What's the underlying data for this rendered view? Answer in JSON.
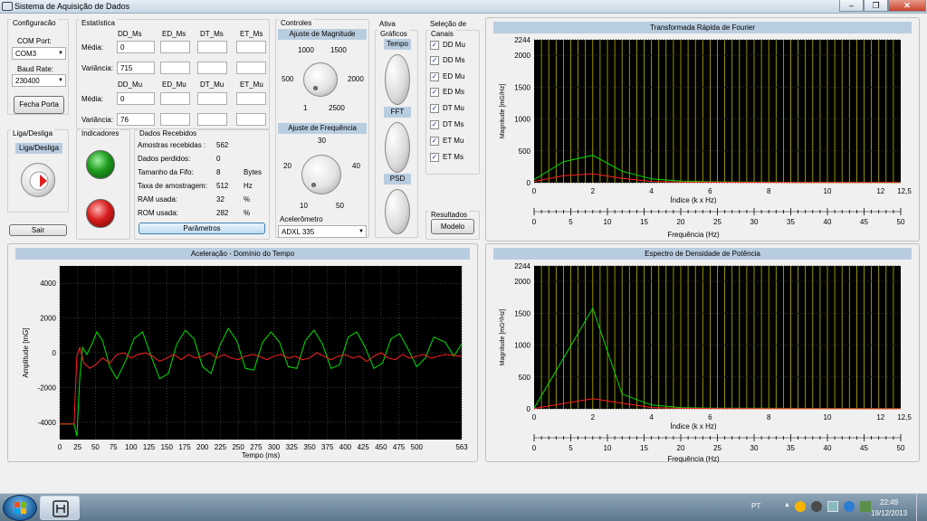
{
  "window": {
    "title": "Sistema de Aquisição de Dados",
    "controls": {
      "minimize": "–",
      "maximize": "❐",
      "close": "✕"
    }
  },
  "config": {
    "group": "Configuracão",
    "com_port_label": "COM Port:",
    "com_port": "COM3",
    "baud_label": "Baud Rate:",
    "baud": "230400",
    "close_port": "Fecha Porta"
  },
  "stats": {
    "group": "Estatística",
    "ms_headers": [
      "DD_Ms",
      "ED_Ms",
      "DT_Ms",
      "ET_Ms"
    ],
    "mu_headers": [
      "DD_Mu",
      "ED_Mu",
      "DT_Mu",
      "ET_Mu"
    ],
    "media_label": "Média:",
    "var_label": "Variância:",
    "ms_media": [
      "0",
      "",
      "",
      ""
    ],
    "ms_var": [
      "715",
      "",
      "",
      ""
    ],
    "mu_media": [
      "0",
      "",
      "",
      ""
    ],
    "mu_var": [
      "76",
      "",
      "",
      ""
    ]
  },
  "power": {
    "group": "Liga/Desliga",
    "label": "Liga/Desliga",
    "exit": "Sair"
  },
  "indicators": {
    "group": "Indicadores",
    "colors": {
      "green": "#1c9b1c",
      "red": "#d81c1c"
    }
  },
  "received": {
    "group": "Dados Recebidos",
    "rows": [
      {
        "label": "Amostras recebidas :",
        "value": "562",
        "unit": ""
      },
      {
        "label": "Dados perdidos:",
        "value": "0",
        "unit": ""
      },
      {
        "label": "Tamanho da Fifo:",
        "value": "8",
        "unit": "Bytes"
      },
      {
        "label": "Taxa de amostragem:",
        "value": "512",
        "unit": "Hz"
      },
      {
        "label": "RAM usada:",
        "value": "32",
        "unit": "%"
      },
      {
        "label": "ROM usada:",
        "value": "282",
        "unit": "%"
      }
    ],
    "params_button": "Parâmetros"
  },
  "controls": {
    "group": "Controles",
    "magnitude_header": "Ajuste de Magnitude",
    "magnitude_ticks": [
      "1000",
      "1500",
      "500",
      "2000",
      "1",
      "2500"
    ],
    "frequency_header": "Ajuste de Frequência",
    "frequency_ticks": [
      "30",
      "20",
      "40",
      "10",
      "50"
    ],
    "accelerometer_label": "Acelerômetro",
    "accelerometer": "ADXL 335"
  },
  "graphs": {
    "group": "Ativa Gráficos",
    "group_line2": "Gráficos",
    "group_line1": "Ativa",
    "items": [
      "Tempo",
      "FFT",
      "PSD"
    ]
  },
  "channels": {
    "group_line1": "Seleção de",
    "group_line2": "Canais",
    "items": [
      "DD Mu",
      "DD Ms",
      "ED Mu",
      "ED Ms",
      "DT Mu",
      "DT Ms",
      "ET Mu",
      "ET Ms"
    ],
    "checked": "✓"
  },
  "results": {
    "group": "Resultados",
    "button": "Modelo"
  },
  "time_plot": {
    "title": "Aceleração - Domínio do Tempo",
    "ylabel": "Amplitude [mG]",
    "xlabel": "Tempo (ms)",
    "yticks": [
      "4000",
      "2000",
      "0",
      "-2000",
      "-4000"
    ],
    "xticks": [
      "0",
      "25",
      "50",
      "75",
      "100",
      "125",
      "150",
      "175",
      "200",
      "225",
      "250",
      "275",
      "300",
      "325",
      "350",
      "375",
      "400",
      "425",
      "450",
      "475",
      "500",
      "563"
    ]
  },
  "fft_plot": {
    "title": "Transformada Rápida de Fourier",
    "ylabel": "Magnitude [mG/Hz]",
    "xlabel": "Índice (k x Hz)",
    "xlabel2": "Frequência (Hz)",
    "yticks": [
      "2244",
      "2000",
      "1500",
      "1000",
      "500",
      "0"
    ],
    "xticks": [
      "0",
      "2",
      "4",
      "6",
      "8",
      "10",
      "12",
      "12,5"
    ],
    "xticks2": [
      "0",
      "5",
      "10",
      "15",
      "20",
      "25",
      "30",
      "35",
      "40",
      "45",
      "50"
    ]
  },
  "psd_plot": {
    "title": "Espectro de Densidade de Potência",
    "ylabel": "Magnitude [mG²/Hz]",
    "xlabel": "Índice (k x Hz)",
    "xlabel2": "Frequência (Hz)",
    "yticks": [
      "2244",
      "2000",
      "1500",
      "1000",
      "500",
      "0"
    ],
    "xticks": [
      "0",
      "2",
      "4",
      "6",
      "8",
      "10",
      "12",
      "12,5"
    ],
    "xticks2": [
      "0",
      "5",
      "10",
      "15",
      "20",
      "25",
      "30",
      "35",
      "40",
      "45",
      "50"
    ]
  },
  "chart_data": [
    {
      "type": "line",
      "title": "Aceleração - Domínio do Tempo",
      "xlabel": "Tempo (ms)",
      "ylabel": "Amplitude [mG]",
      "xlim": [
        0,
        563
      ],
      "ylim": [
        -5000,
        5000
      ],
      "grid": true,
      "series": [
        {
          "color": "#00e000",
          "x": [
            0,
            20,
            24,
            28,
            32,
            38,
            45,
            52,
            60,
            70,
            80,
            92,
            104,
            116,
            128,
            140,
            152,
            164,
            176,
            188,
            200,
            212,
            224,
            236,
            248,
            260,
            272,
            284,
            296,
            308,
            320,
            332,
            344,
            356,
            368,
            380,
            392,
            404,
            416,
            428,
            440,
            452,
            464,
            476,
            488,
            500,
            512,
            524,
            540,
            552,
            563
          ],
          "y": [
            -4100,
            -4100,
            -4800,
            -1500,
            300,
            -100,
            500,
            1200,
            700,
            -800,
            -1500,
            -500,
            800,
            1200,
            -200,
            -1500,
            -1200,
            500,
            1300,
            800,
            -800,
            -1200,
            400,
            1400,
            700,
            -900,
            -1000,
            600,
            1200,
            600,
            -800,
            -900,
            700,
            1300,
            500,
            -900,
            -700,
            900,
            1200,
            300,
            -900,
            -600,
            800,
            1100,
            200,
            -800,
            -300,
            900,
            600,
            -200,
            500
          ]
        },
        {
          "color": "#ff2020",
          "x": [
            0,
            20,
            24,
            28,
            34,
            42,
            50,
            60,
            70,
            80,
            90,
            100,
            110,
            120,
            130,
            140,
            150,
            160,
            170,
            180,
            190,
            200,
            210,
            220,
            230,
            240,
            250,
            260,
            270,
            280,
            290,
            300,
            310,
            320,
            330,
            340,
            350,
            360,
            370,
            380,
            390,
            400,
            410,
            420,
            430,
            440,
            450,
            460,
            470,
            480,
            490,
            500,
            510,
            520,
            530,
            540,
            563
          ],
          "y": [
            -4100,
            -4100,
            -200,
            300,
            -600,
            -900,
            -700,
            -300,
            -600,
            -100,
            0,
            -300,
            -100,
            0,
            -200,
            -500,
            -300,
            -100,
            -400,
            -100,
            -300,
            -200,
            0,
            -300,
            -100,
            -300,
            -400,
            -200,
            -100,
            -200,
            -400,
            -200,
            -100,
            -300,
            -200,
            -400,
            -300,
            0,
            -200,
            -400,
            -200,
            -100,
            -300,
            -200,
            -500,
            -200,
            0,
            -300,
            -400,
            -100,
            -300,
            -200,
            -100,
            -300,
            -200,
            -100,
            -200
          ]
        }
      ]
    },
    {
      "type": "line",
      "title": "Transformada Rápida de Fourier",
      "xlabel": "Índice (k x Hz)",
      "ylabel": "Magnitude [mG/Hz]",
      "xlim": [
        0,
        12.5
      ],
      "ylim": [
        0,
        2244
      ],
      "series": [
        {
          "color": "#00e000",
          "x": [
            0,
            1,
            2,
            3,
            4,
            5,
            6,
            7,
            8,
            9,
            10,
            11,
            12,
            12.5
          ],
          "y": [
            50,
            330,
            430,
            180,
            60,
            25,
            15,
            10,
            8,
            6,
            5,
            5,
            4,
            4
          ]
        },
        {
          "color": "#ff2020",
          "x": [
            0,
            1,
            2,
            3,
            4,
            5,
            6,
            7,
            8,
            9,
            10,
            11,
            12,
            12.5
          ],
          "y": [
            20,
            110,
            140,
            70,
            20,
            10,
            8,
            6,
            5,
            4,
            3,
            3,
            3,
            3
          ]
        }
      ]
    },
    {
      "type": "line",
      "title": "Espectro de Densidade de Potência",
      "xlabel": "Índice (k x Hz)",
      "ylabel": "Magnitude [mG²/Hz]",
      "xlim": [
        0,
        12.5
      ],
      "ylim": [
        0,
        2244
      ],
      "series": [
        {
          "color": "#00e000",
          "x": [
            0,
            2,
            3,
            4,
            5,
            6,
            8,
            10,
            12,
            12.5
          ],
          "y": [
            10,
            1580,
            230,
            60,
            20,
            10,
            8,
            5,
            4,
            4
          ]
        },
        {
          "color": "#ff2020",
          "x": [
            0,
            2,
            3,
            4,
            5,
            6,
            8,
            10,
            12,
            12.5
          ],
          "y": [
            5,
            160,
            90,
            20,
            8,
            5,
            4,
            3,
            2,
            2
          ]
        }
      ]
    }
  ],
  "taskbar": {
    "lang": "PT",
    "time": "22:49",
    "date": "19/12/2013",
    "tray_arrow": "▲"
  }
}
